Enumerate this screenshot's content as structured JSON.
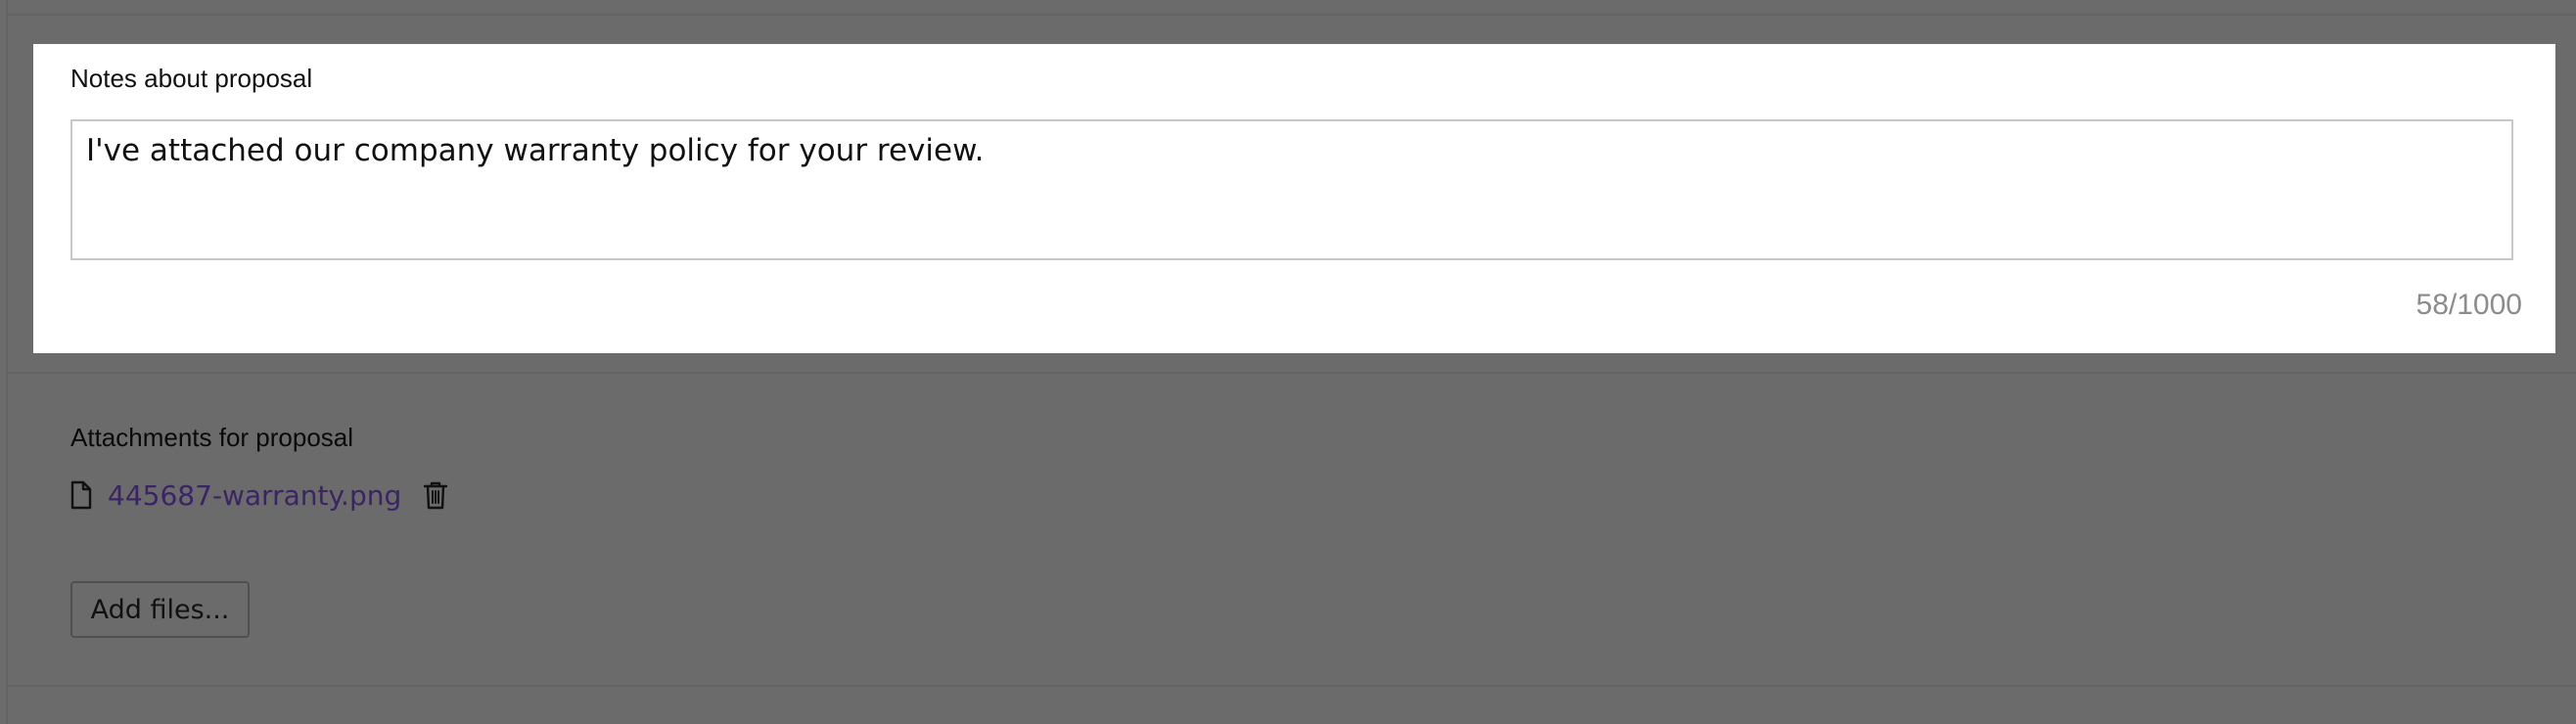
{
  "notes": {
    "label": "Notes about proposal",
    "value": "I've attached our company warranty policy for your review.",
    "counter": "58/1000"
  },
  "attachments": {
    "label": "Attachments for proposal",
    "files": [
      {
        "name": "445687-warranty.png",
        "icon": "file-icon",
        "delete_icon": "trash-icon"
      }
    ],
    "add_button_label": "Add files..."
  },
  "colors": {
    "overlay": "#6b6b6b",
    "card": "#ffffff",
    "link": "#3b2466",
    "counter": "#8c8c8c"
  }
}
